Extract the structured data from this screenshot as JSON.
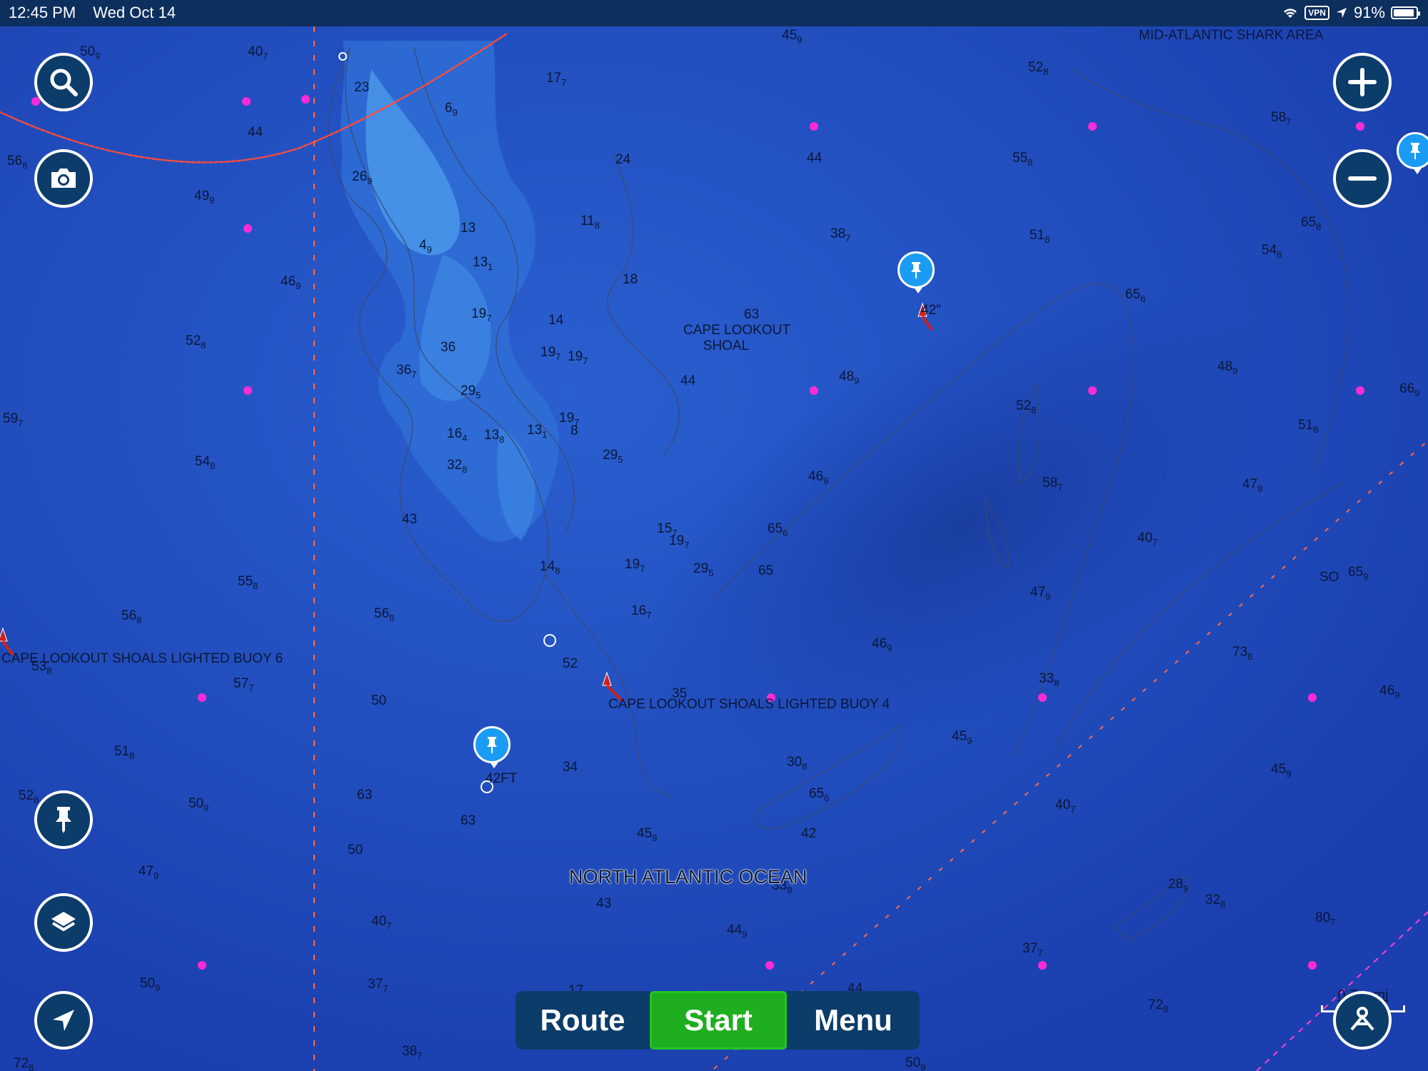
{
  "status_bar": {
    "time": "12:45 PM",
    "date": "Wed Oct 14",
    "vpn": "VPN",
    "battery": "91%"
  },
  "map_labels": {
    "shark_area": "MID-ATLANTIC SHARK AREA",
    "shoal_line1": "CAPE LOOKOUT",
    "shoal_line2": "SHOAL",
    "buoy6": "CAPE LOOKOUT SHOALS LIGHTED BUOY 6",
    "buoy4": "CAPE LOOKOUT SHOALS LIGHTED BUOY 4",
    "ocean": "NORTH ATLANTIC OCEAN",
    "pin_depth1": "42FT",
    "pin_depth2": "42\"",
    "so": "SO"
  },
  "depths": [
    {
      "v": "50",
      "s": "9"
    },
    {
      "v": "40",
      "s": "7"
    },
    {
      "v": "23",
      "s": ""
    },
    {
      "v": "17",
      "s": "7"
    },
    {
      "v": "6",
      "s": "9"
    },
    {
      "v": "45",
      "s": "9"
    },
    {
      "v": "52",
      "s": "8"
    },
    {
      "v": "58",
      "s": "7"
    },
    {
      "v": "44",
      "s": ""
    },
    {
      "v": "56",
      "s": "8"
    },
    {
      "v": "26",
      "s": "9"
    },
    {
      "v": "24",
      "s": ""
    },
    {
      "v": "44",
      "s": ""
    },
    {
      "v": "55",
      "s": "8"
    },
    {
      "v": "49",
      "s": "9"
    },
    {
      "v": "13",
      "s": ""
    },
    {
      "v": "11",
      "s": "8"
    },
    {
      "v": "4",
      "s": "9"
    },
    {
      "v": "13",
      "s": "1"
    },
    {
      "v": "38",
      "s": "7"
    },
    {
      "v": "51",
      "s": "8"
    },
    {
      "v": "65",
      "s": "8"
    },
    {
      "v": "54",
      "s": "8"
    },
    {
      "v": "46",
      "s": "9"
    },
    {
      "v": "18",
      "s": ""
    },
    {
      "v": "65",
      "s": "6"
    },
    {
      "v": "19",
      "s": "7"
    },
    {
      "v": "14",
      "s": ""
    },
    {
      "v": "36",
      "s": ""
    },
    {
      "v": "63",
      "s": ""
    },
    {
      "v": "52",
      "s": "8"
    },
    {
      "v": "19",
      "s": "7"
    },
    {
      "v": "19",
      "s": "7"
    },
    {
      "v": "36",
      "s": "7"
    },
    {
      "v": "48",
      "s": "9"
    },
    {
      "v": "48",
      "s": "9"
    },
    {
      "v": "29",
      "s": "5"
    },
    {
      "v": "44",
      "s": ""
    },
    {
      "v": "66",
      "s": "9"
    },
    {
      "v": "52",
      "s": "8"
    },
    {
      "v": "59",
      "s": "7"
    },
    {
      "v": "19",
      "s": "7"
    },
    {
      "v": "16",
      "s": "4"
    },
    {
      "v": "13",
      "s": "8"
    },
    {
      "v": "13",
      "s": "1"
    },
    {
      "v": "8",
      "s": ""
    },
    {
      "v": "51",
      "s": "8"
    },
    {
      "v": "29",
      "s": "5"
    },
    {
      "v": "54",
      "s": "8"
    },
    {
      "v": "32",
      "s": "8"
    },
    {
      "v": "46",
      "s": "9"
    },
    {
      "v": "58",
      "s": "7"
    },
    {
      "v": "47",
      "s": "9"
    },
    {
      "v": "43",
      "s": ""
    },
    {
      "v": "15",
      "s": "7"
    },
    {
      "v": "19",
      "s": "7"
    },
    {
      "v": "65",
      "s": "6"
    },
    {
      "v": "40",
      "s": "7"
    },
    {
      "v": "55",
      "s": "8"
    },
    {
      "v": "14",
      "s": "8"
    },
    {
      "v": "19",
      "s": "7"
    },
    {
      "v": "29",
      "s": "5"
    },
    {
      "v": "65",
      "s": ""
    },
    {
      "v": "65",
      "s": "9"
    },
    {
      "v": "47",
      "s": "9"
    },
    {
      "v": "56",
      "s": "8"
    },
    {
      "v": "56",
      "s": "8"
    },
    {
      "v": "16",
      "s": "7"
    },
    {
      "v": "46",
      "s": "9"
    },
    {
      "v": "73",
      "s": "8"
    },
    {
      "v": "52",
      "s": ""
    },
    {
      "v": "53",
      "s": "8"
    },
    {
      "v": "33",
      "s": "8"
    },
    {
      "v": "57",
      "s": "7"
    },
    {
      "v": "35",
      "s": ""
    },
    {
      "v": "46",
      "s": "9"
    },
    {
      "v": "50",
      "s": ""
    },
    {
      "v": "45",
      "s": "9"
    },
    {
      "v": "51",
      "s": "8"
    },
    {
      "v": "34",
      "s": ""
    },
    {
      "v": "30",
      "s": "8"
    },
    {
      "v": "45",
      "s": "9"
    },
    {
      "v": "52",
      "s": "8"
    },
    {
      "v": "50",
      "s": "9"
    },
    {
      "v": "63",
      "s": ""
    },
    {
      "v": "65",
      "s": "6"
    },
    {
      "v": "40",
      "s": "7"
    },
    {
      "v": "63",
      "s": ""
    },
    {
      "v": "50",
      "s": ""
    },
    {
      "v": "45",
      "s": "9"
    },
    {
      "v": "42",
      "s": ""
    },
    {
      "v": "47",
      "s": "9"
    },
    {
      "v": "43",
      "s": ""
    },
    {
      "v": "33",
      "s": "8"
    },
    {
      "v": "28",
      "s": "9"
    },
    {
      "v": "32",
      "s": "8"
    },
    {
      "v": "40",
      "s": "7"
    },
    {
      "v": "44",
      "s": "9"
    },
    {
      "v": "80",
      "s": "7"
    },
    {
      "v": "37",
      "s": "7"
    },
    {
      "v": "50",
      "s": "9"
    },
    {
      "v": "37",
      "s": "7"
    },
    {
      "v": "44",
      "s": ""
    },
    {
      "v": "17",
      "s": ""
    },
    {
      "v": "72",
      "s": "8"
    },
    {
      "v": "38",
      "s": "7"
    },
    {
      "v": "72",
      "s": "8"
    },
    {
      "v": "50",
      "s": "9"
    }
  ],
  "toolbar": {
    "route": "Route",
    "start": "Start",
    "menu": "Menu"
  },
  "scale": {
    "value": "0.7",
    "unit": "mi"
  },
  "icons": {
    "search": "magnifier-icon",
    "camera": "camera-icon",
    "zoom_in": "plus-icon",
    "zoom_out": "minus-icon",
    "waypoint": "pushpin-icon",
    "layers": "layers-icon",
    "locate": "location-arrow-icon",
    "profile": "person-icon"
  },
  "colors": {
    "water": "#1f47b8",
    "shallow": "#3f8de0",
    "button": "#0b3c6a",
    "start": "#1fae1f",
    "pin": "#1a9cf5",
    "boundary": "#ff4b3a",
    "marker": "#ff2bd6"
  }
}
